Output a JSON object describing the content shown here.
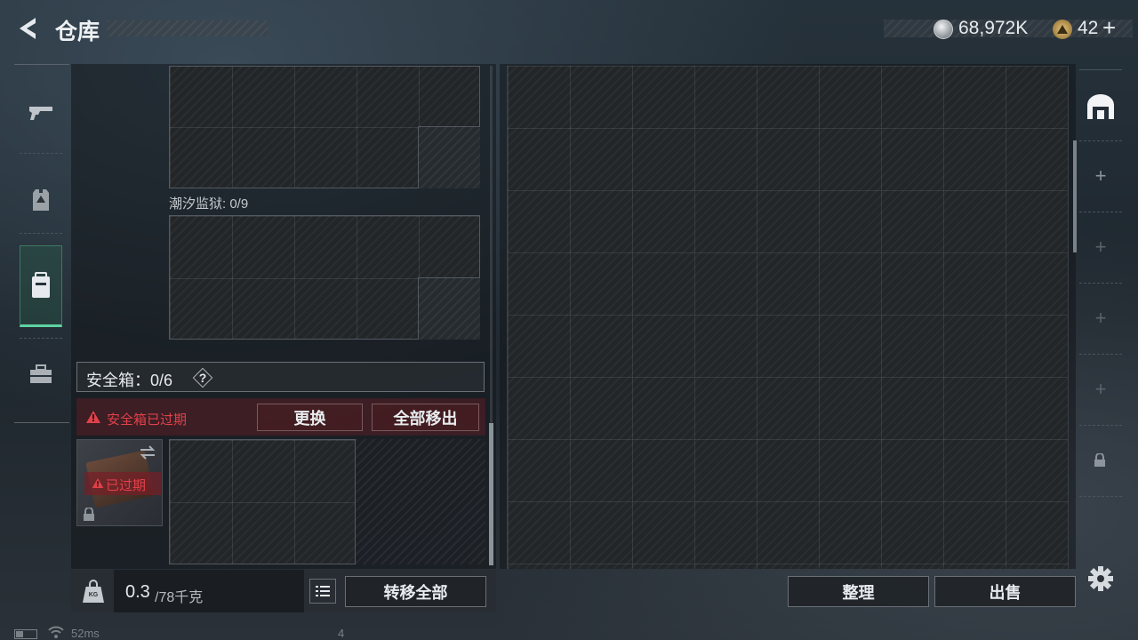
{
  "header": {
    "title": "仓库",
    "currency1": "68,972K",
    "currency2": "42",
    "plus": "+"
  },
  "sidebar": {
    "items": [
      {
        "name": "weapon"
      },
      {
        "name": "armor"
      },
      {
        "name": "backpack",
        "active": true
      },
      {
        "name": "toolbox"
      }
    ]
  },
  "inventory": {
    "section_label": "潮汐监狱: 0/9",
    "safebox_label": "安全箱：0/6",
    "help": "?",
    "expired_warning": "安全箱已过期",
    "replace_button": "更换",
    "remove_all_button": "全部移出",
    "expired_badge": "已过期",
    "weight_value": "0.3",
    "weight_max": "/78千克",
    "kg_icon_text": "KG",
    "transfer_all_button": "转移全部"
  },
  "stash": {
    "sort_button": "整理",
    "sell_button": "出售"
  },
  "status": {
    "ping": "52ms",
    "count": "4"
  },
  "colors": {
    "warning": "#e0414a",
    "active_green": "#5fd3a0"
  }
}
